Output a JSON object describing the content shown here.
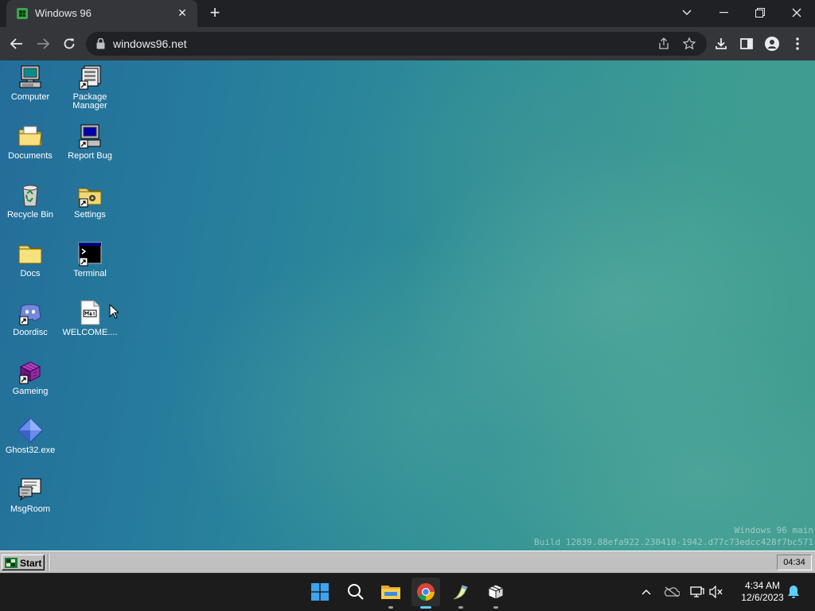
{
  "browser": {
    "tab_title": "Windows 96",
    "url": "windows96.net"
  },
  "desktop": {
    "icons": [
      {
        "label": "Computer",
        "icon": "computer-icon"
      },
      {
        "label": "Package Manager",
        "icon": "package-manager-icon"
      },
      {
        "label": "Documents",
        "icon": "documents-folder-icon"
      },
      {
        "label": "Report Bug",
        "icon": "report-bug-icon"
      },
      {
        "label": "Recycle Bin",
        "icon": "recycle-bin-icon"
      },
      {
        "label": "Settings",
        "icon": "settings-folder-icon"
      },
      {
        "label": "Docs",
        "icon": "docs-folder-icon"
      },
      {
        "label": "Terminal",
        "icon": "terminal-icon"
      },
      {
        "label": "Doordisc",
        "icon": "doordisc-icon"
      },
      {
        "label": "WELCOME....",
        "icon": "markdown-file-icon"
      },
      {
        "label": "Gameing",
        "icon": "gameing-icon"
      },
      {
        "label": "Ghost32.exe",
        "icon": "ghost32-icon"
      },
      {
        "label": "MsgRoom",
        "icon": "msgroom-icon"
      }
    ],
    "build_line1": "Windows 96 main",
    "build_line2": "Build 12839.88efa922.230410-1942.d77c73edcc428f7bc571"
  },
  "w96_taskbar": {
    "start_label": "Start",
    "clock": "04:34"
  },
  "win11_taskbar": {
    "time": "4:34 AM",
    "date": "12/6/2023",
    "apps": [
      "start-icon",
      "search-icon",
      "file-explorer-icon",
      "chrome-icon",
      "pen-app-icon",
      "package-app-icon"
    ]
  },
  "colors": {
    "chrome_dark": "#202124",
    "chrome_toolbar": "#35363a",
    "win96_gray": "#c0c0c0",
    "win11_taskbar": "#1c1c1c",
    "active_indicator": "#60cdff"
  }
}
